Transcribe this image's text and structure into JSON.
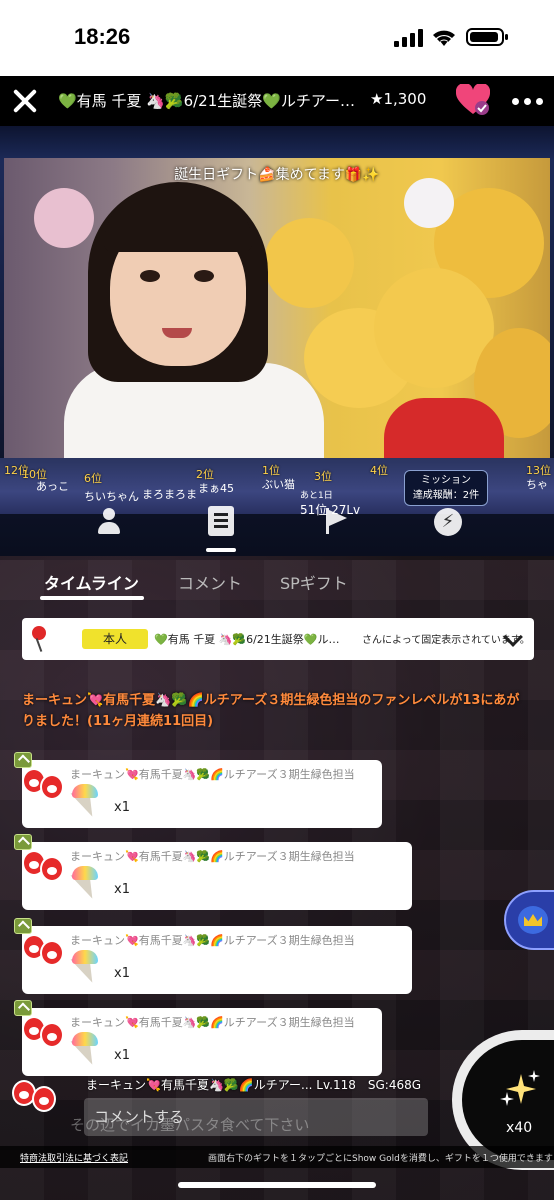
{
  "status_bar": {
    "time": "18:26"
  },
  "header": {
    "title": "💚有馬 千夏 🦄🥦6/21生誕祭💚ルチアー…",
    "star_count": "★1,300"
  },
  "video": {
    "banner": "誕生日ギフト🍰集めてます🎁✨",
    "ranks": [
      {
        "rank": "12位",
        "name": "あっこ"
      },
      {
        "rank": "10位",
        "name": "ちいちゃん"
      },
      {
        "rank": "6位",
        "name": "まろまろま"
      },
      {
        "rank": "2位",
        "name": "まぁ45"
      },
      {
        "rank": "1位",
        "name": "ぶい猫"
      },
      {
        "rank": "3位",
        "name": "あと1日"
      },
      {
        "rank": "4位",
        "name": ""
      },
      {
        "rank": "13位",
        "name": "ちゃ"
      }
    ],
    "level_sub": "あと1日",
    "level": "51位 27Lv",
    "mission_title": "ミッション",
    "mission_reward": "達成報酬：2件"
  },
  "tabs": [
    {
      "label": "タイムライン",
      "active": true
    },
    {
      "label": "コメント",
      "active": false
    },
    {
      "label": "SPギフト",
      "active": false
    }
  ],
  "pinned": {
    "badge": "本人",
    "name": "💚有馬 千夏 🦄🥦6/21生誕祭💚ルチア…",
    "note": "さんによって固定表示されています。"
  },
  "fan_message": "まーキュン💘有馬千夏🦄🥦🌈ルチアーズ３期生緑色担当のファンレベルが13にあがりました！(11ヶ月連続11回目)",
  "gifts": [
    {
      "user": "まーキュン💘有馬千夏🦄🥦🌈ルチアーズ３期生緑色担当",
      "qty": "x1"
    },
    {
      "user": "まーキュン💘有馬千夏🦄🥦🌈ルチアーズ３期生緑色担当",
      "qty": "x1"
    },
    {
      "user": "まーキュン💘有馬千夏🦄🥦🌈ルチアーズ３期生緑色担当",
      "qty": "x1"
    },
    {
      "user": "まーキュン💘有馬千夏🦄🥦🌈ルチアーズ３期生緑色担当",
      "qty": "x1"
    }
  ],
  "bottom": {
    "user_line": "まーキュン💘有馬千夏🦄🥦🌈ルチアー... Lv.118　SG:468G",
    "comment_placeholder": "コメントする",
    "bg_text": "その辺でイカ墨パスタ食べて下さい",
    "gift_count": "x40",
    "legal_link": "特商法取引法に基づく表記",
    "gift_note": "画面右下のギフトを１タップごとにShow Goldを消費し、ギフトを１つ使用できます"
  },
  "colors": {
    "accent_orange": "#ff8a3c",
    "badge_yellow": "#f0e22c",
    "heart_pink": "#f0457a"
  }
}
